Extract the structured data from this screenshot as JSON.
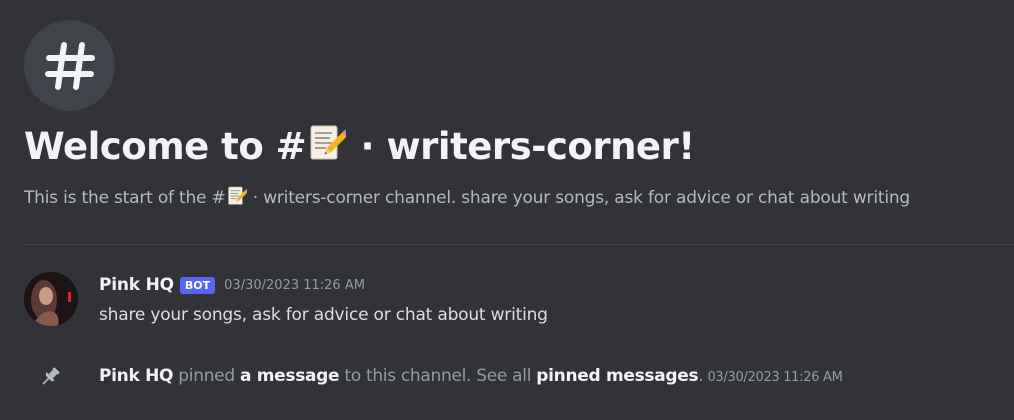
{
  "channel": {
    "icon": "hash-icon",
    "welcome_prefix": "Welcome to #",
    "emoji": "memo-emoji",
    "welcome_suffix": " · writers-corner!",
    "desc_prefix": "This is the start of the #",
    "desc_suffix": " · writers-corner channel. share your songs, ask for advice or chat about writing"
  },
  "message": {
    "author": "Pink HQ",
    "badge": "BOT",
    "timestamp": "03/30/2023 11:26 AM",
    "text": "share your songs, ask for advice or chat about writing"
  },
  "system_message": {
    "icon": "pin-icon",
    "author": "Pink HQ",
    "pinned_word": " pinned ",
    "link_message": "a message",
    "middle": " to this channel. See all ",
    "link_pinned": "pinned messages",
    "end": ".",
    "timestamp": "03/30/2023 11:26 AM"
  },
  "colors": {
    "background": "#313338",
    "bot_badge": "#5865f2",
    "muted_text": "#949ba4"
  }
}
